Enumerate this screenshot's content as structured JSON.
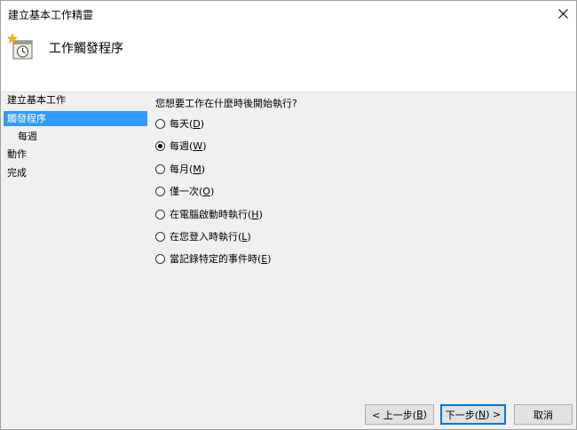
{
  "window": {
    "title": "建立基本工作精靈"
  },
  "header": {
    "title": "工作觸發程序"
  },
  "nav": {
    "items": [
      {
        "label": "建立基本工作"
      },
      {
        "label": "觸發程序"
      },
      {
        "label": "每週"
      },
      {
        "label": "動作"
      },
      {
        "label": "完成"
      }
    ]
  },
  "content": {
    "question": "您想要工作在什麼時後開始執行?",
    "options": [
      {
        "label": "每天",
        "key": "D",
        "checked": false
      },
      {
        "label": "每週",
        "key": "W",
        "checked": true
      },
      {
        "label": "每月",
        "key": "M",
        "checked": false
      },
      {
        "label": "僅一次",
        "key": "O",
        "checked": false
      },
      {
        "label": "在電腦啟動時執行",
        "key": "H",
        "checked": false
      },
      {
        "label": "在您登入時執行",
        "key": "L",
        "checked": false
      },
      {
        "label": "當記錄特定的事件時",
        "key": "E",
        "checked": false
      }
    ]
  },
  "buttons": {
    "back": {
      "prefix": "< 上一步(",
      "key": "B",
      "suffix": ")"
    },
    "next": {
      "prefix": "下一步(",
      "key": "N",
      "suffix": ") >"
    },
    "cancel": {
      "label": "取消"
    }
  }
}
